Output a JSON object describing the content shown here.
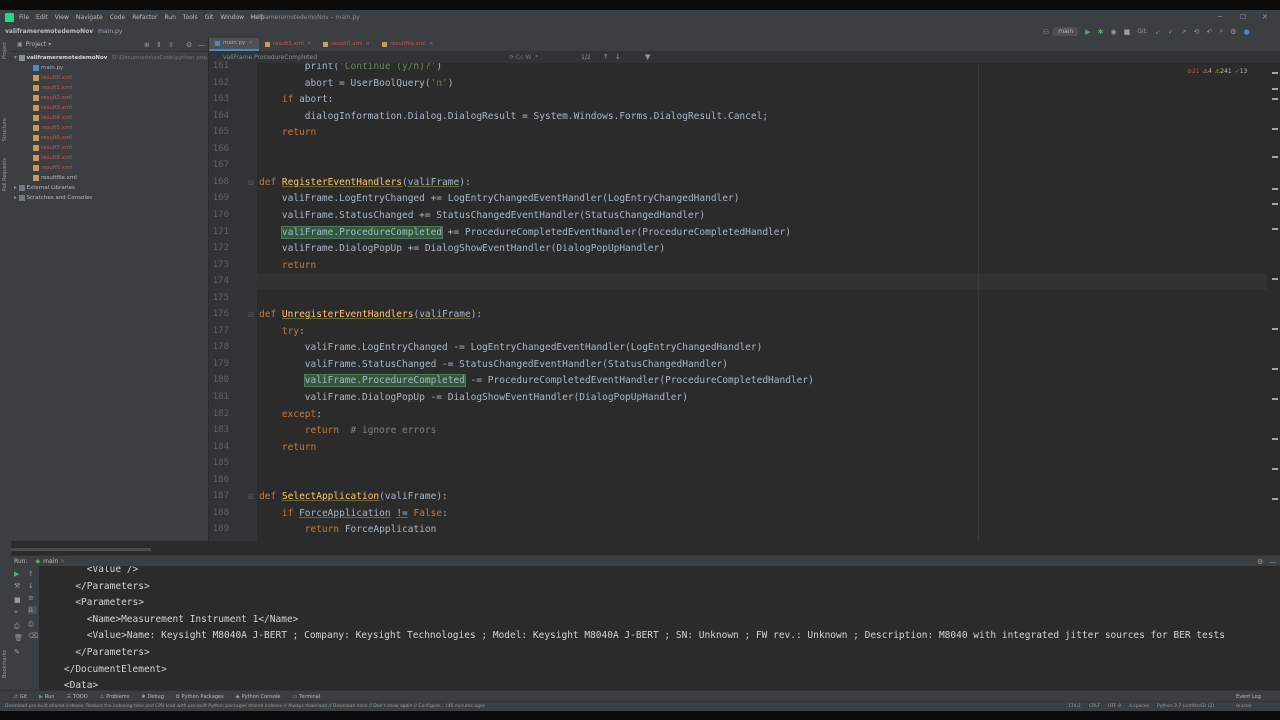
{
  "window": {
    "title": "valiframeremotedemoNov – main.py",
    "project_name": "valiframeremotedemoNov",
    "current_file": "main.py"
  },
  "menu": [
    "File",
    "Edit",
    "View",
    "Navigate",
    "Code",
    "Refactor",
    "Run",
    "Tools",
    "Git",
    "Window",
    "Help"
  ],
  "toolbar": {
    "run_config": "main",
    "git_label": "Git:"
  },
  "project_panel": {
    "title": "Project",
    "root": "valiframeremotedemoNov",
    "root_path": "D:\\Documents\\vsCode\\python proj",
    "files": [
      {
        "name": "main.py",
        "color": "blue"
      },
      {
        "name": "result0.xml",
        "color": "red"
      },
      {
        "name": "result1.xml",
        "color": "red"
      },
      {
        "name": "result2.xml",
        "color": "red"
      },
      {
        "name": "result3.xml",
        "color": "red"
      },
      {
        "name": "result4.xml",
        "color": "red"
      },
      {
        "name": "result5.xml",
        "color": "red"
      },
      {
        "name": "result6.xml",
        "color": "red"
      },
      {
        "name": "result7.xml",
        "color": "red"
      },
      {
        "name": "result8.xml",
        "color": "red"
      },
      {
        "name": "result9.xml",
        "color": "red"
      },
      {
        "name": "resultfile.xml",
        "color": "gray"
      }
    ],
    "external": "External Libraries",
    "scratches": "Scratches and Consoles"
  },
  "tabs": [
    {
      "label": "main.py",
      "active": true
    },
    {
      "label": "result1.xml",
      "active": false
    },
    {
      "label": "result0.xml",
      "active": false
    },
    {
      "label": "resultfile.xml",
      "active": false
    }
  ],
  "editor_crumb": "valiFrame.ProcedureCompleted",
  "find_count": "1/2",
  "inspections": {
    "errors": "21",
    "warnings": "4",
    "weak": "241",
    "typos": "13"
  },
  "code_lines": [
    {
      "n": "161",
      "html": "        print(<span class=\"str\">'Continue (y/n)?'</span>)"
    },
    {
      "n": "162",
      "html": "        abort = UserBoolQuery(<span class=\"str\">'n'</span>)"
    },
    {
      "n": "163",
      "html": "    <span class=\"kw\">if</span> abort:"
    },
    {
      "n": "164",
      "html": "        dialogInformation.Dialog.DialogResult = System.Windows.Forms.DialogResult.Cancel;"
    },
    {
      "n": "165",
      "html": "    <span class=\"kw\">return</span>"
    },
    {
      "n": "166",
      "html": ""
    },
    {
      "n": "167",
      "html": ""
    },
    {
      "n": "168",
      "html": "<span class=\"kw\">def</span> <span class=\"fn\">RegisterEventHandlers</span>(<span style=\"text-decoration:underline;text-decoration-color:#6a6a38\">valiFrame</span>):"
    },
    {
      "n": "169",
      "html": "    valiFrame.LogEntryChanged += LogEntryChangedEventHandler(LogEntryChangedHandler)"
    },
    {
      "n": "170",
      "html": "    valiFrame.StatusChanged += StatusChangedEventHandler(StatusChangedHandler)"
    },
    {
      "n": "171",
      "html": "    <span class=\"hl\">valiFrame.ProcedureCompleted</span> += ProcedureCompletedEventHandler(ProcedureCompletedHandler)"
    },
    {
      "n": "172",
      "html": "    valiFrame.DialogPopUp += DialogShowEventHandler(DialogPopUpHandler)"
    },
    {
      "n": "173",
      "html": "    <span class=\"kw\">return</span>"
    },
    {
      "n": "174",
      "html": ""
    },
    {
      "n": "175",
      "html": ""
    },
    {
      "n": "176",
      "html": "<span class=\"kw\">def</span> <span class=\"fn\">UnregisterEventHandlers</span>(<span style=\"text-decoration:underline;text-decoration-color:#6a6a38\">valiFrame</span>):"
    },
    {
      "n": "177",
      "html": "    <span class=\"kw\">try</span>:"
    },
    {
      "n": "178",
      "html": "        valiFrame.LogEntryChanged -= LogEntryChangedEventHandler(LogEntryChangedHandler)"
    },
    {
      "n": "179",
      "html": "        valiFrame.StatusChanged -= StatusChangedEventHandler(StatusChangedHandler)"
    },
    {
      "n": "180",
      "html": "        <span class=\"hl\">valiFrame.ProcedureCompleted</span> -= ProcedureCompletedEventHandler(ProcedureCompletedHandler)"
    },
    {
      "n": "181",
      "html": "        valiFrame.DialogPopUp -= DialogShowEventHandler(DialogPopUpHandler)"
    },
    {
      "n": "182",
      "html": "    <span class=\"kw\">except</span>:"
    },
    {
      "n": "183",
      "html": "        <span class=\"kw\">return</span>  <span class=\"cm\"># ignore errors</span>"
    },
    {
      "n": "184",
      "html": "    <span class=\"kw\">return</span>"
    },
    {
      "n": "185",
      "html": ""
    },
    {
      "n": "186",
      "html": ""
    },
    {
      "n": "187",
      "html": "<span class=\"kw\">def</span> <span class=\"fn\">SelectApplication</span>(valiFrame):"
    },
    {
      "n": "188",
      "html": "    <span class=\"kw\">if</span> <span style=\"text-decoration:underline;text-decoration-color:#6a6a38\">ForceApplication</span> <span style=\"text-decoration:underline;text-decoration-color:#6a6a38\">!=</span> <span class=\"kw\">False</span>:"
    },
    {
      "n": "189",
      "html": "        <span class=\"kw\">return</span> ForceApplication"
    }
  ],
  "run_panel": {
    "label": "Run:",
    "config": "main"
  },
  "console_lines": [
    "        <Value />",
    "      </Parameters>",
    "      <Parameters>",
    "        <Name>Measurement Instrument 1</Name>",
    "        <Value>Name: Keysight M8040A J-BERT ; Company: Keysight Technologies ; Model: Keysight M8040A J-BERT ; SN: Unknown ; FW rev.: Unknown ; Description: M8040 with integrated jitter sources for BER tests",
    "      </Parameters>",
    "    </DocumentElement>",
    "    <Data>"
  ],
  "bottom_tabs": [
    "Git",
    "Run",
    "TODO",
    "Problems",
    "Debug",
    "Python Packages",
    "Python Console",
    "Terminal"
  ],
  "event_log": "Event Log",
  "status": {
    "message": "Download pre-built shared indexes: Reduce the indexing time and CPU load with pre-built Python packages shared indexes // Always download // Download once // Don't show again // Configure... (46 minutes ago)",
    "position": "174:1",
    "line_sep": "CRLF",
    "encoding": "UTF-8",
    "indent": "4 spaces",
    "interpreter": "Python 3.7 (untitled3) (2)",
    "branch": "master"
  },
  "colors": {
    "accent": "#4a88c7",
    "highlight": "#32593d",
    "keyword": "#cc7832",
    "function": "#ffc66d"
  }
}
